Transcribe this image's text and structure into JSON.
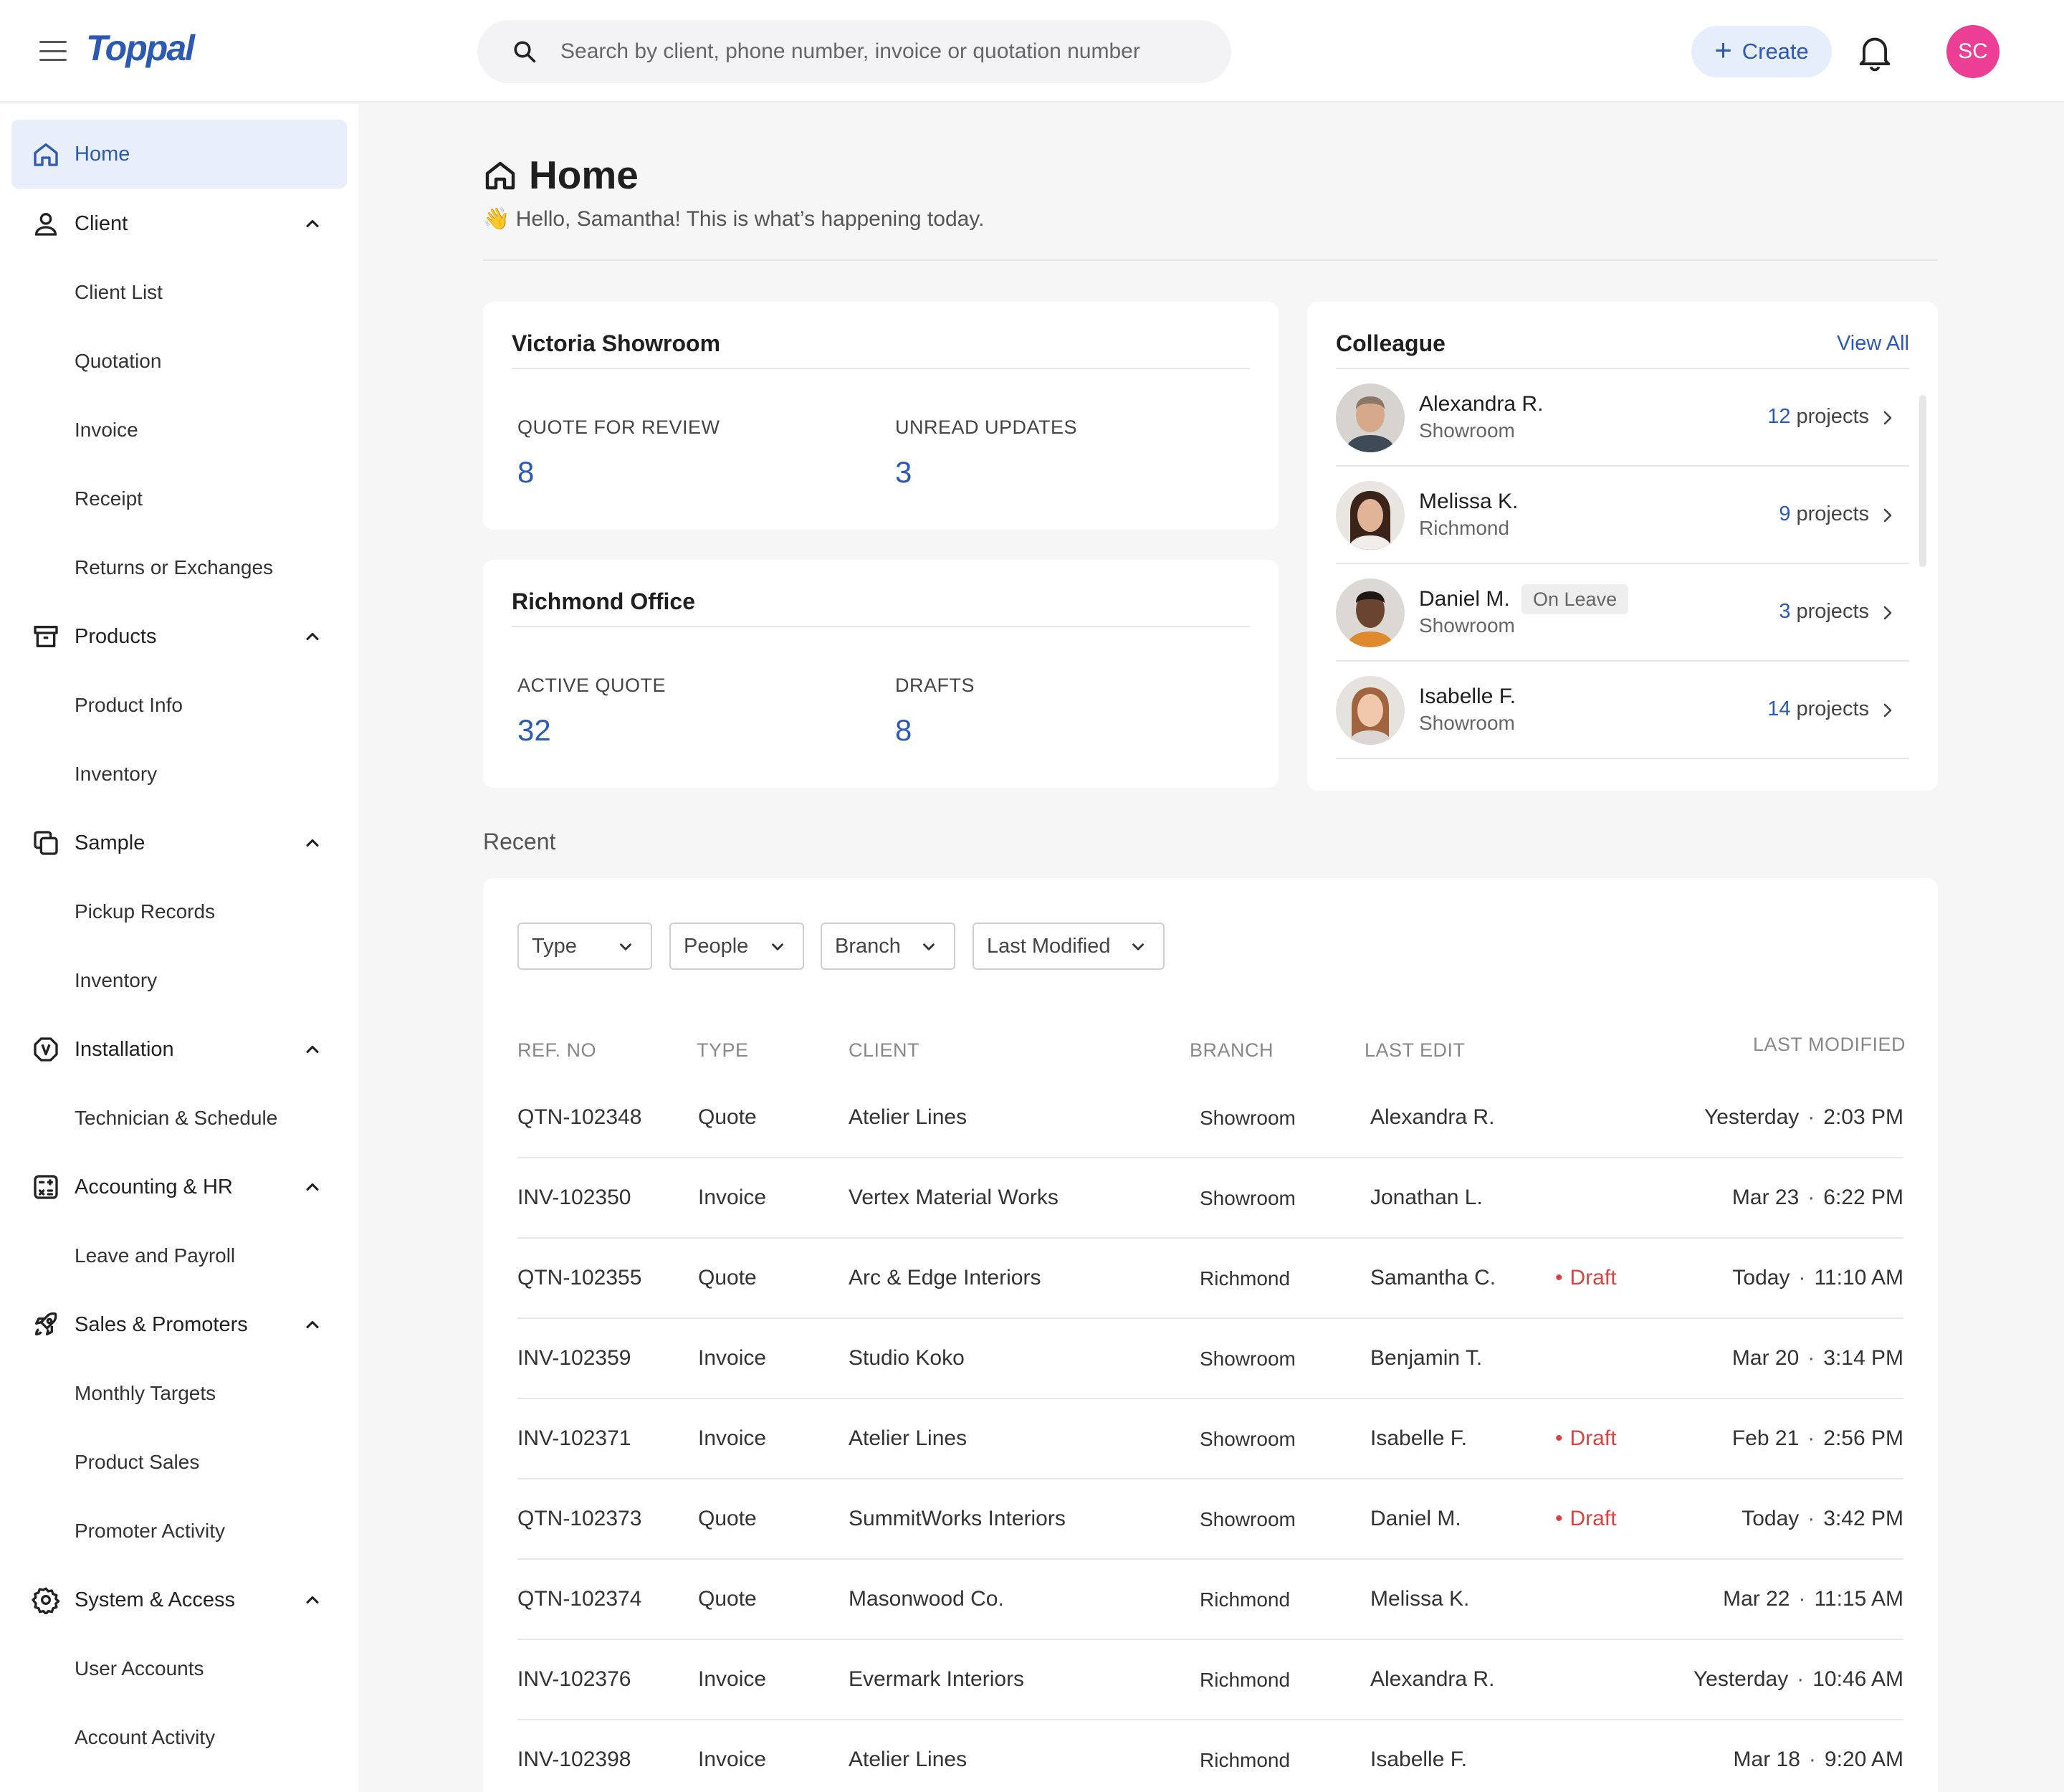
{
  "app": {
    "logo": "Toppal"
  },
  "search": {
    "placeholder": "Search by client, phone number, invoice or quotation number"
  },
  "header": {
    "create_label": "Create",
    "user_initials": "SC"
  },
  "sidebar": {
    "home": "Home",
    "sections": [
      {
        "label": "Client",
        "children": [
          "Client List",
          "Quotation",
          "Invoice",
          "Receipt",
          "Returns or Exchanges"
        ]
      },
      {
        "label": "Products",
        "children": [
          "Product Info",
          "Inventory"
        ]
      },
      {
        "label": "Sample",
        "children": [
          "Pickup Records",
          "Inventory"
        ]
      },
      {
        "label": "Installation",
        "children": [
          "Technician & Schedule"
        ]
      },
      {
        "label": "Accounting & HR",
        "children": [
          "Leave and Payroll"
        ]
      },
      {
        "label": "Sales & Promoters",
        "children": [
          "Monthly Targets",
          "Product Sales",
          "Promoter Activity"
        ]
      },
      {
        "label": "System & Access",
        "children": [
          "User Accounts",
          "Account Activity"
        ]
      }
    ]
  },
  "page": {
    "title": "Home",
    "greeting": "👋 Hello, Samantha! This is what’s happening today."
  },
  "cards": {
    "victoria": {
      "title": "Victoria Showroom",
      "stat1_label": "QUOTE FOR REVIEW",
      "stat1_value": "8",
      "stat2_label": "UNREAD UPDATES",
      "stat2_value": "3"
    },
    "richmond": {
      "title": "Richmond Office",
      "stat1_label": "ACTIVE QUOTE",
      "stat1_value": "32",
      "stat2_label": "DRAFTS",
      "stat2_value": "8"
    }
  },
  "colleague": {
    "title": "Colleague",
    "view_all": "View All",
    "projects_label": "projects",
    "people": [
      {
        "name": "Alexandra R.",
        "branch": "Showroom",
        "projects": "12",
        "badge": ""
      },
      {
        "name": "Melissa K.",
        "branch": "Richmond",
        "projects": "9",
        "badge": ""
      },
      {
        "name": "Daniel M.",
        "branch": "Showroom",
        "projects": "3",
        "badge": "On Leave"
      },
      {
        "name": "Isabelle F.",
        "branch": "Showroom",
        "projects": "14",
        "badge": ""
      }
    ]
  },
  "recent": {
    "label": "Recent",
    "filters": [
      "Type",
      "People",
      "Branch",
      "Last Modified"
    ],
    "columns": [
      "REF. NO",
      "TYPE",
      "CLIENT",
      "BRANCH",
      "LAST EDIT",
      "LAST MODIFIED"
    ],
    "rows": [
      {
        "ref": "QTN-102348",
        "type": "Quote",
        "client": "Atelier Lines",
        "branch": "Showroom",
        "editor": "Alexandra R.",
        "status": "",
        "day": "Yesterday",
        "time": "2:03 PM"
      },
      {
        "ref": "INV-102350",
        "type": "Invoice",
        "client": "Vertex Material Works",
        "branch": "Showroom",
        "editor": "Jonathan L.",
        "status": "",
        "day": "Mar 23",
        "time": "6:22 PM"
      },
      {
        "ref": "QTN-102355",
        "type": "Quote",
        "client": "Arc & Edge Interiors",
        "branch": "Richmond",
        "editor": "Samantha C.",
        "status": "Draft",
        "day": "Today",
        "time": "11:10 AM"
      },
      {
        "ref": "INV-102359",
        "type": "Invoice",
        "client": "Studio Koko",
        "branch": "Showroom",
        "editor": "Benjamin T.",
        "status": "",
        "day": "Mar 20",
        "time": "3:14 PM"
      },
      {
        "ref": "INV-102371",
        "type": "Invoice",
        "client": "Atelier Lines",
        "branch": "Showroom",
        "editor": "Isabelle F.",
        "status": "Draft",
        "day": "Feb 21",
        "time": "2:56 PM"
      },
      {
        "ref": "QTN-102373",
        "type": "Quote",
        "client": "SummitWorks Interiors",
        "branch": "Showroom",
        "editor": "Daniel M.",
        "status": "Draft",
        "day": "Today",
        "time": "3:42 PM"
      },
      {
        "ref": "QTN-102374",
        "type": "Quote",
        "client": "Masonwood Co.",
        "branch": "Richmond",
        "editor": "Melissa K.",
        "status": "",
        "day": "Mar 22",
        "time": "11:15 AM"
      },
      {
        "ref": "INV-102376",
        "type": "Invoice",
        "client": "Evermark Interiors",
        "branch": "Richmond",
        "editor": "Alexandra R.",
        "status": "",
        "day": "Yesterday",
        "time": "10:46 AM"
      },
      {
        "ref": "INV-102398",
        "type": "Invoice",
        "client": "Atelier Lines",
        "branch": "Richmond",
        "editor": "Isabelle F.",
        "status": "",
        "day": "Mar 18",
        "time": "9:20 AM"
      }
    ]
  },
  "colors": {
    "accent": "#2c59b2",
    "avatar": "#ec3e95",
    "draft": "#d94343",
    "active_nav_bg": "#e8eefa"
  }
}
